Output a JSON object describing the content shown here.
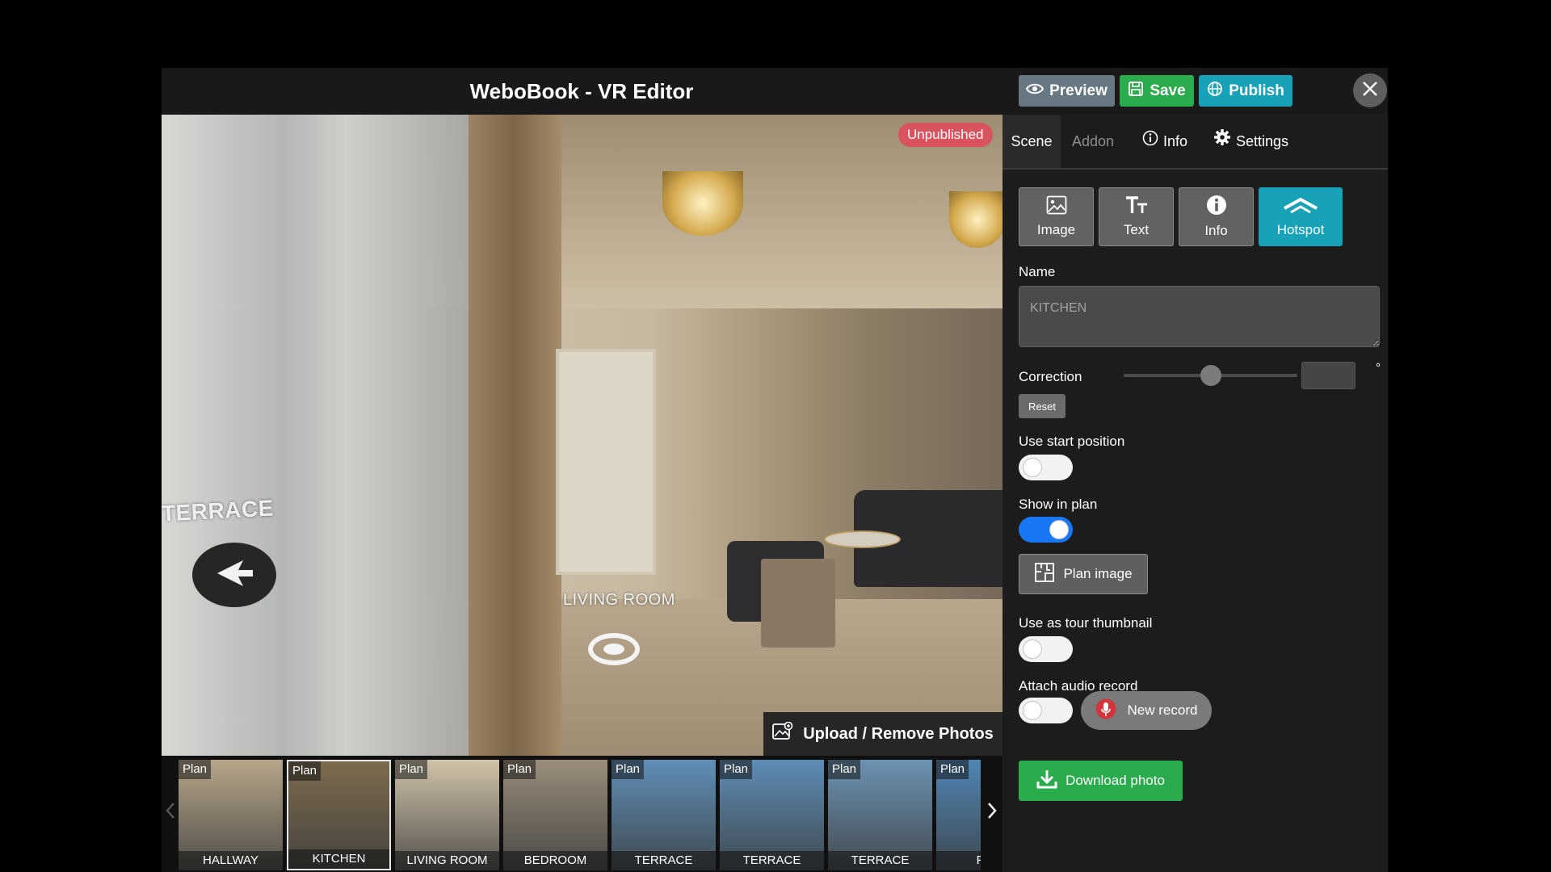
{
  "header": {
    "title": "WeboBook - VR Editor",
    "preview_label": "Preview",
    "save_label": "Save",
    "publish_label": "Publish"
  },
  "viewer": {
    "status_badge": "Unpublished",
    "hotspots": [
      {
        "label": "TERRACE"
      },
      {
        "label": "LIVING ROOM"
      }
    ],
    "upload_label": "Upload / Remove Photos"
  },
  "thumbnails": [
    {
      "tag": "Plan",
      "name": "HALLWAY",
      "color": "#b7a68a"
    },
    {
      "tag": "Plan",
      "name": "KITCHEN",
      "color": "#7d6b4f",
      "selected": true
    },
    {
      "tag": "Plan",
      "name": "LIVING ROOM",
      "color": "#d1c3aa"
    },
    {
      "tag": "Plan",
      "name": "BEDROOM",
      "color": "#9a8d7b"
    },
    {
      "tag": "Plan",
      "name": "TERRACE",
      "color": "#5f8fb8"
    },
    {
      "tag": "Plan",
      "name": "TERRACE",
      "color": "#5d8db6"
    },
    {
      "tag": "Plan",
      "name": "TERRACE",
      "color": "#6c93b3"
    },
    {
      "tag": "Plan",
      "name": "PAN",
      "color": "#4f86b5"
    }
  ],
  "panel": {
    "tabs": {
      "scene": "Scene",
      "addon": "Addon",
      "info": "Info",
      "settings": "Settings"
    },
    "content_types": {
      "image": "Image",
      "text": "Text",
      "info": "Info",
      "hotspot": "Hotspot"
    },
    "name_label": "Name",
    "name_value": "KITCHEN",
    "correction_label": "Correction",
    "correction_value": "",
    "correction_unit": "°",
    "reset_label": "Reset",
    "start_position_label": "Use start position",
    "start_position_on": false,
    "show_in_plan_label": "Show in plan",
    "show_in_plan_on": true,
    "plan_image_label": "Plan image",
    "tour_thumbnail_label": "Use as tour thumbnail",
    "tour_thumbnail_on": false,
    "audio_label": "Attach audio record",
    "audio_on": false,
    "new_record_label": "New record",
    "download_label": "Download photo"
  },
  "colors": {
    "accent": "#17a2b8",
    "save_green": "#2aab4c",
    "toggle_on": "#1877f2",
    "badge_red": "#d9535f"
  }
}
